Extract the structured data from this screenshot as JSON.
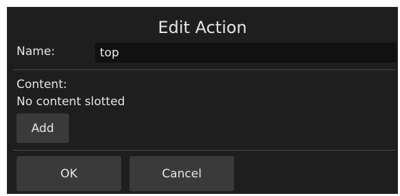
{
  "dialog": {
    "title": "Edit Action",
    "name_label": "Name:",
    "name_value": "top",
    "content_label": "Content:",
    "content_empty_text": "No content slotted",
    "add_label": "Add",
    "ok_label": "OK",
    "cancel_label": "Cancel"
  },
  "colors": {
    "background": "#1e1e1e",
    "input_background": "#111111",
    "button_background": "#3a3a3a",
    "text": "#e6e6e6",
    "divider": "#4a4a4a"
  }
}
